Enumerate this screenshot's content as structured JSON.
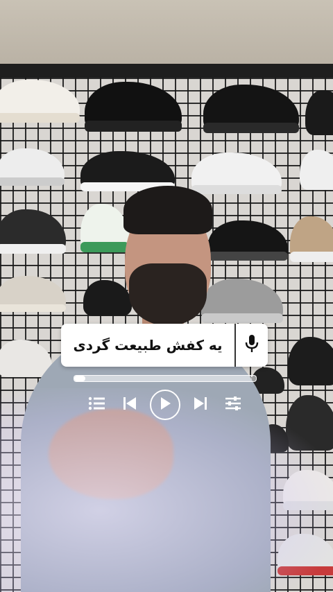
{
  "caption": {
    "text": "یه کفش طبیعت گردی"
  },
  "player": {
    "progress": 0.06,
    "accent": "#ffffff",
    "controls": [
      "playlist-icon",
      "skip-previous-icon",
      "play-icon",
      "skip-next-icon",
      "equalizer-icon"
    ]
  },
  "mic": {
    "icon": "microphone-icon"
  },
  "colors": {
    "card": "#ffffff",
    "caption_text": "#111111",
    "wall_grid": "#1a1a1a"
  }
}
